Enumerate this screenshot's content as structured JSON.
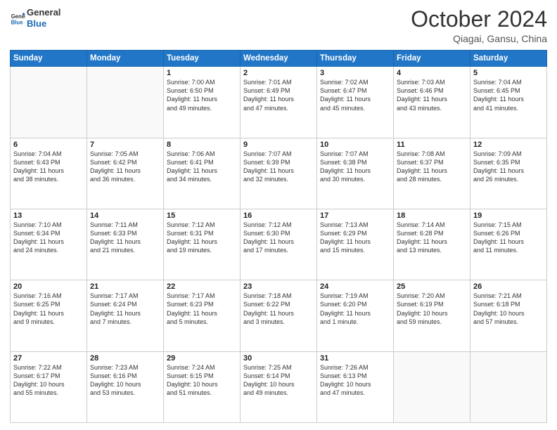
{
  "header": {
    "logo_line1": "General",
    "logo_line2": "Blue",
    "month": "October 2024",
    "location": "Qiagai, Gansu, China"
  },
  "days_of_week": [
    "Sunday",
    "Monday",
    "Tuesday",
    "Wednesday",
    "Thursday",
    "Friday",
    "Saturday"
  ],
  "weeks": [
    [
      {
        "day": "",
        "info": ""
      },
      {
        "day": "",
        "info": ""
      },
      {
        "day": "1",
        "info": "Sunrise: 7:00 AM\nSunset: 6:50 PM\nDaylight: 11 hours\nand 49 minutes."
      },
      {
        "day": "2",
        "info": "Sunrise: 7:01 AM\nSunset: 6:49 PM\nDaylight: 11 hours\nand 47 minutes."
      },
      {
        "day": "3",
        "info": "Sunrise: 7:02 AM\nSunset: 6:47 PM\nDaylight: 11 hours\nand 45 minutes."
      },
      {
        "day": "4",
        "info": "Sunrise: 7:03 AM\nSunset: 6:46 PM\nDaylight: 11 hours\nand 43 minutes."
      },
      {
        "day": "5",
        "info": "Sunrise: 7:04 AM\nSunset: 6:45 PM\nDaylight: 11 hours\nand 41 minutes."
      }
    ],
    [
      {
        "day": "6",
        "info": "Sunrise: 7:04 AM\nSunset: 6:43 PM\nDaylight: 11 hours\nand 38 minutes."
      },
      {
        "day": "7",
        "info": "Sunrise: 7:05 AM\nSunset: 6:42 PM\nDaylight: 11 hours\nand 36 minutes."
      },
      {
        "day": "8",
        "info": "Sunrise: 7:06 AM\nSunset: 6:41 PM\nDaylight: 11 hours\nand 34 minutes."
      },
      {
        "day": "9",
        "info": "Sunrise: 7:07 AM\nSunset: 6:39 PM\nDaylight: 11 hours\nand 32 minutes."
      },
      {
        "day": "10",
        "info": "Sunrise: 7:07 AM\nSunset: 6:38 PM\nDaylight: 11 hours\nand 30 minutes."
      },
      {
        "day": "11",
        "info": "Sunrise: 7:08 AM\nSunset: 6:37 PM\nDaylight: 11 hours\nand 28 minutes."
      },
      {
        "day": "12",
        "info": "Sunrise: 7:09 AM\nSunset: 6:35 PM\nDaylight: 11 hours\nand 26 minutes."
      }
    ],
    [
      {
        "day": "13",
        "info": "Sunrise: 7:10 AM\nSunset: 6:34 PM\nDaylight: 11 hours\nand 24 minutes."
      },
      {
        "day": "14",
        "info": "Sunrise: 7:11 AM\nSunset: 6:33 PM\nDaylight: 11 hours\nand 21 minutes."
      },
      {
        "day": "15",
        "info": "Sunrise: 7:12 AM\nSunset: 6:31 PM\nDaylight: 11 hours\nand 19 minutes."
      },
      {
        "day": "16",
        "info": "Sunrise: 7:12 AM\nSunset: 6:30 PM\nDaylight: 11 hours\nand 17 minutes."
      },
      {
        "day": "17",
        "info": "Sunrise: 7:13 AM\nSunset: 6:29 PM\nDaylight: 11 hours\nand 15 minutes."
      },
      {
        "day": "18",
        "info": "Sunrise: 7:14 AM\nSunset: 6:28 PM\nDaylight: 11 hours\nand 13 minutes."
      },
      {
        "day": "19",
        "info": "Sunrise: 7:15 AM\nSunset: 6:26 PM\nDaylight: 11 hours\nand 11 minutes."
      }
    ],
    [
      {
        "day": "20",
        "info": "Sunrise: 7:16 AM\nSunset: 6:25 PM\nDaylight: 11 hours\nand 9 minutes."
      },
      {
        "day": "21",
        "info": "Sunrise: 7:17 AM\nSunset: 6:24 PM\nDaylight: 11 hours\nand 7 minutes."
      },
      {
        "day": "22",
        "info": "Sunrise: 7:17 AM\nSunset: 6:23 PM\nDaylight: 11 hours\nand 5 minutes."
      },
      {
        "day": "23",
        "info": "Sunrise: 7:18 AM\nSunset: 6:22 PM\nDaylight: 11 hours\nand 3 minutes."
      },
      {
        "day": "24",
        "info": "Sunrise: 7:19 AM\nSunset: 6:20 PM\nDaylight: 11 hours\nand 1 minute."
      },
      {
        "day": "25",
        "info": "Sunrise: 7:20 AM\nSunset: 6:19 PM\nDaylight: 10 hours\nand 59 minutes."
      },
      {
        "day": "26",
        "info": "Sunrise: 7:21 AM\nSunset: 6:18 PM\nDaylight: 10 hours\nand 57 minutes."
      }
    ],
    [
      {
        "day": "27",
        "info": "Sunrise: 7:22 AM\nSunset: 6:17 PM\nDaylight: 10 hours\nand 55 minutes."
      },
      {
        "day": "28",
        "info": "Sunrise: 7:23 AM\nSunset: 6:16 PM\nDaylight: 10 hours\nand 53 minutes."
      },
      {
        "day": "29",
        "info": "Sunrise: 7:24 AM\nSunset: 6:15 PM\nDaylight: 10 hours\nand 51 minutes."
      },
      {
        "day": "30",
        "info": "Sunrise: 7:25 AM\nSunset: 6:14 PM\nDaylight: 10 hours\nand 49 minutes."
      },
      {
        "day": "31",
        "info": "Sunrise: 7:26 AM\nSunset: 6:13 PM\nDaylight: 10 hours\nand 47 minutes."
      },
      {
        "day": "",
        "info": ""
      },
      {
        "day": "",
        "info": ""
      }
    ]
  ]
}
